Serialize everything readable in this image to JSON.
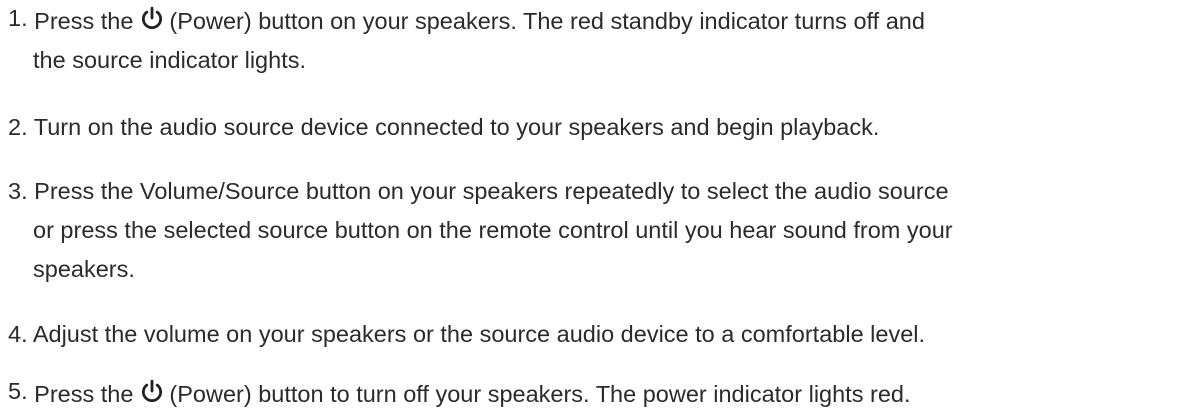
{
  "steps": [
    {
      "number": "1.",
      "before_icon": "Press the",
      "icon": "power-icon",
      "after_icon": "(Power) button on your speakers. The red standby indicator turns off and",
      "line2": "the source indicator lights."
    },
    {
      "number": "2.",
      "text": "Turn on the audio source device connected to your speakers and begin playback."
    },
    {
      "number": "3.",
      "line1": "Press the Volume/Source button on your speakers repeatedly to select the audio source",
      "line2": "or press the selected source button on the remote control until you hear sound from your",
      "line3": "speakers."
    },
    {
      "number": "4.",
      "text": "Adjust the volume on your speakers or the source audio device to a comfortable level."
    },
    {
      "number": "5.",
      "before_icon": "Press the",
      "icon": "power-icon",
      "after_icon": "(Power) button to turn off your speakers. The power indicator lights red."
    }
  ],
  "colors": {
    "text": "#2b2b2b"
  }
}
